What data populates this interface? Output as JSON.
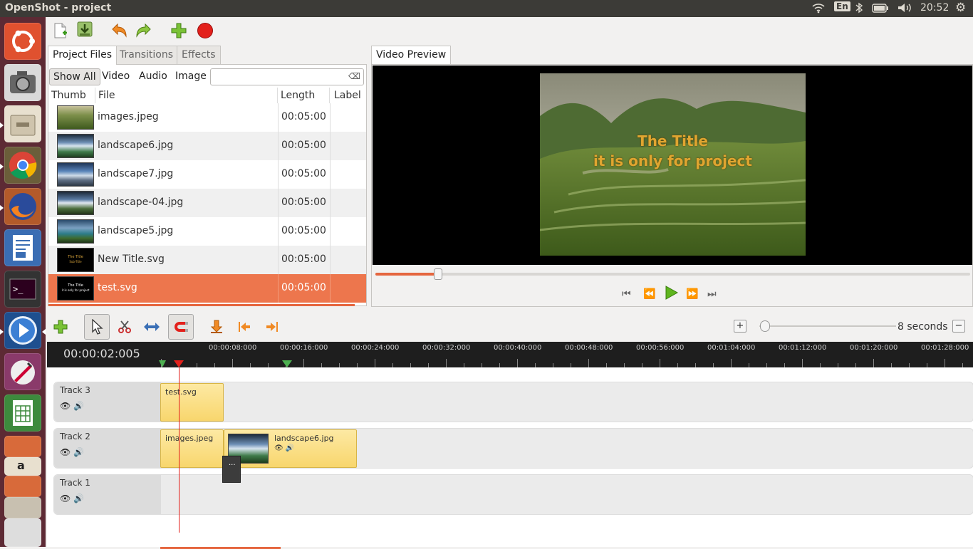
{
  "window": {
    "title": "OpenShot - project"
  },
  "indicators": {
    "keyboard": "En",
    "clock": "20:52"
  },
  "launcher": {
    "items": [
      "ubuntu-logo-icon",
      "camera-icon",
      "files-icon",
      "chrome-icon",
      "firefox-icon",
      "writer-icon",
      "terminal-icon",
      "openshot-icon",
      "gimp-icon",
      "calc-icon",
      "impress-icon",
      "amazon-icon",
      "firefox-icon-2",
      "software-icon",
      "dvd-icon"
    ]
  },
  "toolbar": {
    "buttons": [
      "new-project",
      "save-project",
      "undo",
      "redo",
      "import-files",
      "export-video"
    ]
  },
  "left_tabs": [
    "Project Files",
    "Transitions",
    "Effects"
  ],
  "filter_tabs": [
    "Show All",
    "Video",
    "Audio",
    "Image"
  ],
  "filter_search": {
    "value": "",
    "placeholder": ""
  },
  "columns": {
    "thumb": "Thumb",
    "file": "File",
    "length": "Length",
    "label": "Label"
  },
  "files": [
    {
      "name": "images.jpeg",
      "length": "00:05:00"
    },
    {
      "name": "landscape6.jpg",
      "length": "00:05:00"
    },
    {
      "name": "landscape7.jpg",
      "length": "00:05:00"
    },
    {
      "name": "landscape-04.jpg",
      "length": "00:05:00"
    },
    {
      "name": "landscape5.jpg",
      "length": "00:05:00"
    },
    {
      "name": "New Title.svg",
      "length": "00:05:00"
    },
    {
      "name": "test.svg",
      "length": "00:05:00"
    }
  ],
  "thumb_texts": {
    "new_title": [
      "The Title",
      "Sub-Title"
    ],
    "test": [
      "The Title",
      "it is only for project"
    ]
  },
  "preview": {
    "tab": "Video Preview",
    "title_line1": "The Title",
    "title_line2": "it is only for project",
    "seek_fraction": 0.105
  },
  "timeline": {
    "current_time": "00:00:02:005",
    "zoom_label": "8 seconds",
    "ticks": [
      "00:00:08:000",
      "00:00:16:000",
      "00:00:24:000",
      "00:00:32:000",
      "00:00:40:000",
      "00:00:48:000",
      "00:00:56:000",
      "00:01:04:000",
      "00:01:12:000",
      "00:01:20:000",
      "00:01:28:000"
    ],
    "tracks": [
      {
        "name": "Track 3",
        "clips": [
          {
            "name": "test.svg"
          }
        ]
      },
      {
        "name": "Track 2",
        "clips": [
          {
            "name": "images.jpeg"
          },
          {
            "name": "landscape6.jpg"
          }
        ]
      },
      {
        "name": "Track 1",
        "clips": []
      }
    ],
    "clip_dots": "..."
  },
  "colors": {
    "accent": "#ed764d",
    "launcher": "#5d2a34",
    "clip": "#f8d66d"
  }
}
